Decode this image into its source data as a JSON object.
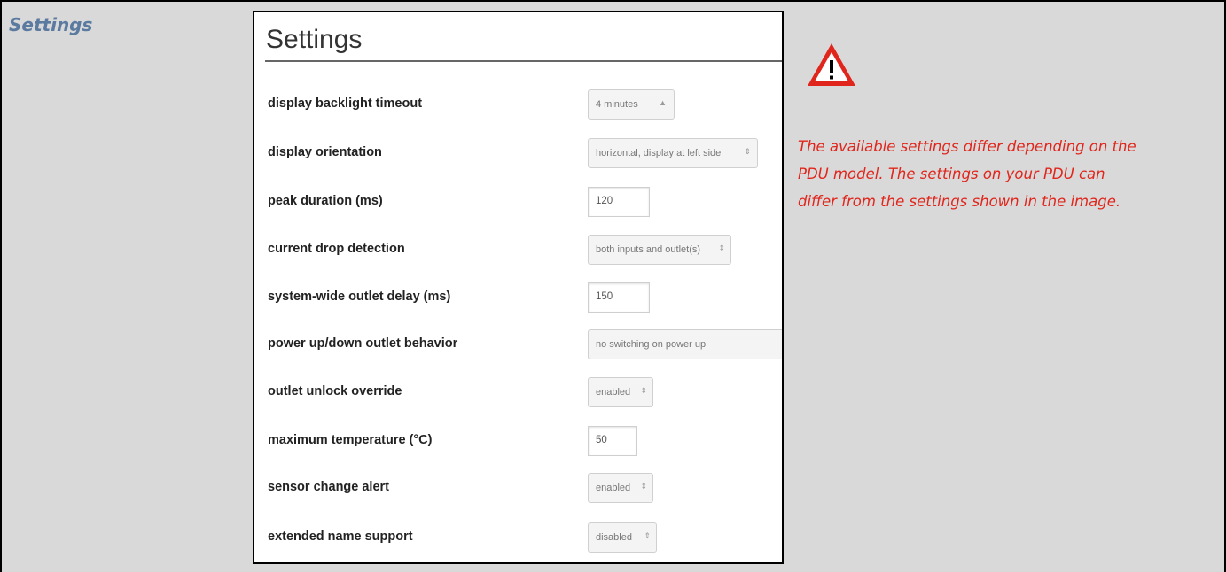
{
  "page": {
    "section_title": "Settings"
  },
  "dialog": {
    "title": "Settings",
    "rows": [
      {
        "label": "display backlight timeout",
        "value": "4 minutes",
        "kind": "select"
      },
      {
        "label": "display orientation",
        "value": "horizontal, display at left side",
        "kind": "select"
      },
      {
        "label": "peak duration (ms)",
        "value": "120",
        "kind": "input"
      },
      {
        "label": "current drop detection",
        "value": "both inputs and outlet(s)",
        "kind": "select"
      },
      {
        "label": "system-wide outlet delay (ms)",
        "value": "150",
        "kind": "input"
      },
      {
        "label": "power up/down outlet behavior",
        "value": "no switching on power up",
        "kind": "select"
      },
      {
        "label": "outlet unlock override",
        "value": "enabled",
        "kind": "select"
      },
      {
        "label": "maximum temperature (°C)",
        "value": "50",
        "kind": "input"
      },
      {
        "label": "sensor change alert",
        "value": "enabled",
        "kind": "select"
      },
      {
        "label": "extended name support",
        "value": "disabled",
        "kind": "select"
      }
    ]
  },
  "note": {
    "icon": "warning-icon",
    "color": "#e0261c",
    "lines": [
      "The available settings differ depending on the",
      "PDU model. The settings on your PDU can",
      "differ from the settings shown in the image."
    ]
  }
}
